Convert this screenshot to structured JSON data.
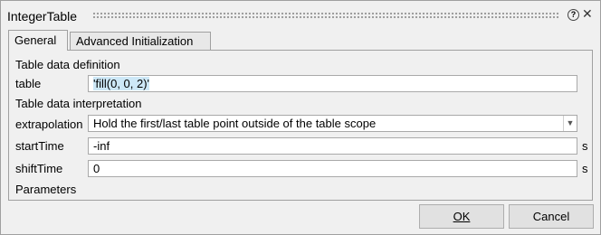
{
  "window": {
    "title": "IntegerTable"
  },
  "tabs": [
    {
      "label": "General",
      "active": true
    },
    {
      "label": "Advanced Initialization",
      "active": false
    }
  ],
  "sections": {
    "table_def": "Table data definition",
    "table_interp": "Table data interpretation",
    "parameters": "Parameters"
  },
  "fields": {
    "table": {
      "label": "table",
      "value": "'fill(0, 0, 2)'"
    },
    "extrapolation": {
      "label": "extrapolation",
      "value": "Hold the first/last table point outside of the table scope"
    },
    "startTime": {
      "label": "startTime",
      "value": "-inf",
      "unit": "s"
    },
    "shiftTime": {
      "label": "shiftTime",
      "value": "0",
      "unit": "s"
    }
  },
  "buttons": {
    "ok": "OK",
    "cancel": "Cancel"
  },
  "icons": {
    "help": "help-icon",
    "close": "close-icon",
    "dropdown": "chevron-down-icon"
  }
}
